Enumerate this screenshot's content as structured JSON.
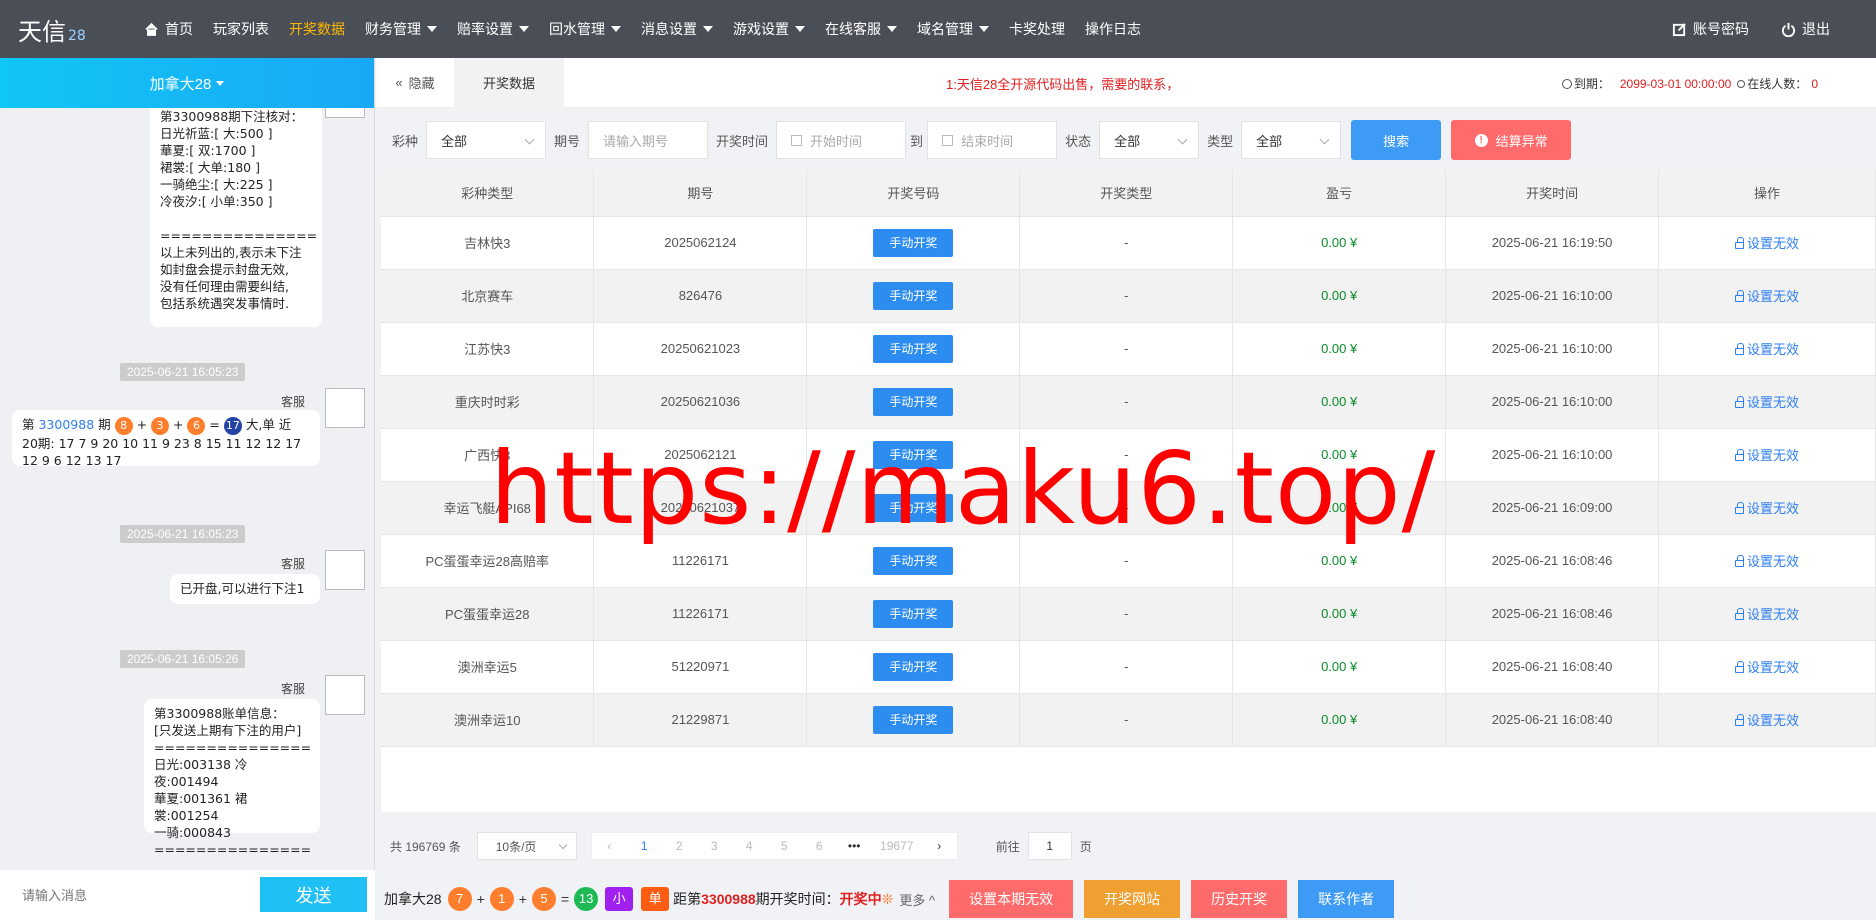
{
  "header": {
    "logo": "天信",
    "logo_sub": "28",
    "nav": [
      {
        "label": "首页",
        "icon": "home-icon",
        "dropdown": false,
        "active": false
      },
      {
        "label": "玩家列表",
        "dropdown": false,
        "active": false
      },
      {
        "label": "开奖数据",
        "dropdown": false,
        "active": true
      },
      {
        "label": "财务管理",
        "dropdown": true,
        "active": false
      },
      {
        "label": "赔率设置",
        "dropdown": true,
        "active": false
      },
      {
        "label": "回水管理",
        "dropdown": true,
        "active": false
      },
      {
        "label": "消息设置",
        "dropdown": true,
        "active": false
      },
      {
        "label": "游戏设置",
        "dropdown": true,
        "active": false
      },
      {
        "label": "在线客服",
        "dropdown": true,
        "active": false
      },
      {
        "label": "域名管理",
        "dropdown": true,
        "active": false
      },
      {
        "label": "卡奖处理",
        "dropdown": false,
        "active": false
      },
      {
        "label": "操作日志",
        "dropdown": false,
        "active": false
      }
    ],
    "account_label": "账号密码",
    "logout_label": "退出"
  },
  "sidebar": {
    "room_title": "加拿大28",
    "messages": {
      "msg1_text": "第3300988期下注核对：\n日光祈蓝:[ 大:500 ]\n華夏:[ 双:1700 ]\n裙裳:[ 大单:180 ]\n一骑绝尘:[ 大:225 ]\n冷夜汐:[ 小单:350 ]\n\n===============\n以上未列出的,表示未下注\n如封盘会提示封盘无效,\n没有任何理由需要纠结,\n包括系统遇突发事情时.",
      "time2": "2025-06-21 16:05:23",
      "sender2": "客服",
      "msg2_prefix": "第 ",
      "msg2_period": "3300988",
      "msg2_qi": " 期 ",
      "msg2_b1": "8",
      "msg2_b2": "3",
      "msg2_b3": "6",
      "msg2_sum": "17",
      "msg2_result": " 大,单 近",
      "msg2_line2": "20期: 17 7 9 20 10 11 9 23 8 15 11 12 12 17",
      "msg2_line3": "12 9 6 12 13 17",
      "time3": "2025-06-21 16:05:23",
      "sender3": "客服",
      "msg3_text": "已开盘,可以进行下注1",
      "time4": "2025-06-21 16:05:26",
      "sender4": "客服",
      "msg4_text": "第3300988账单信息：\n[只发送上期有下注的用户]\n===============\n日光:003138 冷夜:001494\n華夏:001361 裙裳:001254\n一骑:000843\n==============="
    },
    "input_placeholder": "请输入消息",
    "send_label": "发送"
  },
  "main": {
    "hide_label": "隐藏",
    "tab_label": "开奖数据",
    "notice": "1:天信28全开源代码出售，需要的联系，",
    "expire_label": "到期：",
    "expire_value": "2099-03-01 00:00:00",
    "online_label": "在线人数：",
    "online_value": "0"
  },
  "filters": {
    "lottery_label": "彩种",
    "lottery_value": "全部",
    "period_label": "期号",
    "period_placeholder": "请输入期号",
    "time_label": "开奖时间",
    "start_placeholder": "开始时间",
    "to_label": "到",
    "end_placeholder": "结束时间",
    "status_label": "状态",
    "status_value": "全部",
    "type_label": "类型",
    "type_value": "全部",
    "search_label": "搜索",
    "abnormal_label": "结算异常"
  },
  "table": {
    "columns": [
      "彩种类型",
      "期号",
      "开奖号码",
      "开奖类型",
      "盈亏",
      "开奖时间",
      "操作"
    ],
    "rows": [
      {
        "lottery": "吉林快3",
        "period": "2025062124",
        "button": "手动开奖",
        "type": "-",
        "profit": "0.00 ¥",
        "time": "2025-06-21 16:19:50",
        "action": "设置无效"
      },
      {
        "lottery": "北京赛车",
        "period": "826476",
        "button": "手动开奖",
        "type": "-",
        "profit": "0.00 ¥",
        "time": "2025-06-21 16:10:00",
        "action": "设置无效"
      },
      {
        "lottery": "江苏快3",
        "period": "20250621023",
        "button": "手动开奖",
        "type": "-",
        "profit": "0.00 ¥",
        "time": "2025-06-21 16:10:00",
        "action": "设置无效"
      },
      {
        "lottery": "重庆时时彩",
        "period": "20250621036",
        "button": "手动开奖",
        "type": "-",
        "profit": "0.00 ¥",
        "time": "2025-06-21 16:10:00",
        "action": "设置无效"
      },
      {
        "lottery": "广西快3",
        "period": "2025062121",
        "button": "手动开奖",
        "type": "-",
        "profit": "0.00 ¥",
        "time": "2025-06-21 16:10:00",
        "action": "设置无效"
      },
      {
        "lottery": "幸运飞艇API68",
        "period": "20250621037",
        "button": "手动开奖",
        "type": "-",
        "profit": "0.00 ¥",
        "time": "2025-06-21 16:09:00",
        "action": "设置无效"
      },
      {
        "lottery": "PC蛋蛋幸运28高赔率",
        "period": "11226171",
        "button": "手动开奖",
        "type": "-",
        "profit": "0.00 ¥",
        "time": "2025-06-21 16:08:46",
        "action": "设置无效"
      },
      {
        "lottery": "PC蛋蛋幸运28",
        "period": "11226171",
        "button": "手动开奖",
        "type": "-",
        "profit": "0.00 ¥",
        "time": "2025-06-21 16:08:46",
        "action": "设置无效"
      },
      {
        "lottery": "澳洲幸运5",
        "period": "51220971",
        "button": "手动开奖",
        "type": "-",
        "profit": "0.00 ¥",
        "time": "2025-06-21 16:08:40",
        "action": "设置无效"
      },
      {
        "lottery": "澳洲幸运10",
        "period": "21229871",
        "button": "手动开奖",
        "type": "-",
        "profit": "0.00 ¥",
        "time": "2025-06-21 16:08:40",
        "action": "设置无效"
      }
    ]
  },
  "pagination": {
    "total": "共 196769 条",
    "page_size": "10条/页",
    "prev": "‹",
    "pages": [
      "1",
      "2",
      "3",
      "4",
      "5",
      "6",
      "•••",
      "19677"
    ],
    "next": "›",
    "goto_label": "前往",
    "goto_value": "1",
    "page_unit": "页"
  },
  "bottom": {
    "room": "加拿大28",
    "b1": "7",
    "b2": "1",
    "b3": "5",
    "sum": "13",
    "size": "小",
    "parity": "单",
    "prefix": "距第",
    "period": "3300988",
    "suffix": "期开奖时间：",
    "status": "开奖中",
    "more": "更多",
    "buttons": [
      {
        "label": "设置本期无效",
        "color": "#ff6b6b"
      },
      {
        "label": "开奖网站",
        "color": "#f0a030"
      },
      {
        "label": "历史开奖",
        "color": "#ff6b6b"
      },
      {
        "label": "联系作者",
        "color": "#3d9af5"
      }
    ]
  },
  "watermark": "https://maku6.top/"
}
